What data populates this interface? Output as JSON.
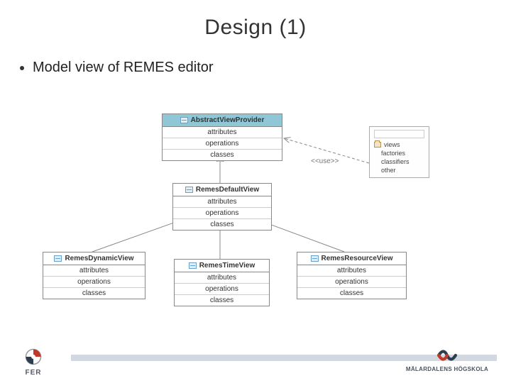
{
  "title": "Design (1)",
  "bullet": "Model view of REMES editor",
  "classes": {
    "abstract": {
      "name": "AbstractViewProvider",
      "rows": [
        "attributes",
        "operations",
        "classes"
      ]
    },
    "default": {
      "name": "RemesDefaultView",
      "rows": [
        "attributes",
        "operations",
        "classes"
      ]
    },
    "dynamic": {
      "name": "RemesDynamicView",
      "rows": [
        "attributes",
        "operations",
        "classes"
      ]
    },
    "time": {
      "name": "RemesTimeView",
      "rows": [
        "attributes",
        "operations",
        "classes"
      ]
    },
    "resource": {
      "name": "RemesResourceView",
      "rows": [
        "attributes",
        "operations",
        "classes"
      ]
    }
  },
  "reference_outline": {
    "pkg": "views",
    "items": [
      "factories",
      "classifiers",
      "other"
    ]
  },
  "use_stereotype": "<<use>>",
  "footer": {
    "left_label": "FER",
    "right_label": "MÄLARDALENS HÖGSKOLA"
  }
}
